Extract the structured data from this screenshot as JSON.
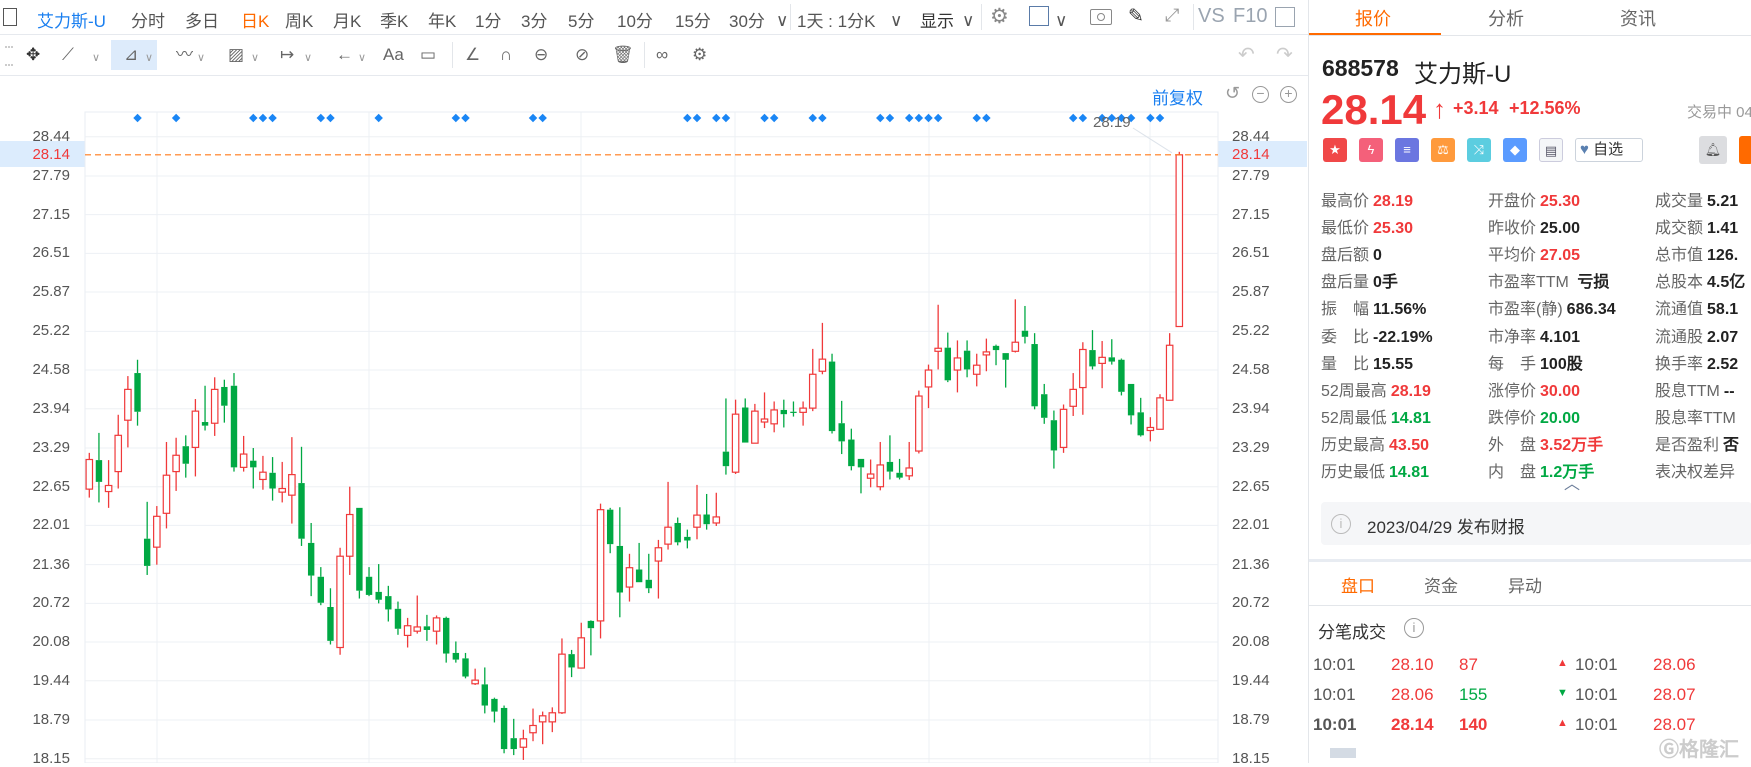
{
  "toolbar": {
    "stock_name": "艾力斯-U",
    "periods": [
      "分时",
      "多日",
      "日K",
      "周K",
      "月K",
      "季K",
      "年K",
      "1分",
      "3分",
      "5分",
      "10分",
      "15分",
      "30分"
    ],
    "active_period": "日K",
    "interval_select": "1天 : 1分K",
    "display_select": "显示",
    "vs": "VS",
    "f10": "F10"
  },
  "drawing_tools": [
    "move-icon",
    "line-icon",
    "polyline-icon",
    "wave-icon",
    "fibonacci-icon",
    "measure-icon",
    "arrow-icon",
    "text-icon",
    "comment-icon",
    "angle-icon",
    "magnet-icon",
    "link-icon",
    "hide-icon",
    "trash-icon",
    "overlay-icon",
    "settings-icon"
  ],
  "chart": {
    "adjust_label": "前复权",
    "high_label": "28.19",
    "current_price_label": "28.14"
  },
  "chart_data": {
    "type": "candlestick",
    "y_ticks": [
      "28.44",
      "27.79",
      "27.15",
      "26.51",
      "25.87",
      "25.22",
      "24.58",
      "23.94",
      "23.29",
      "22.65",
      "22.01",
      "21.36",
      "20.72",
      "20.08",
      "19.44",
      "18.79",
      "18.15"
    ],
    "ylim": [
      18.15,
      28.44
    ],
    "current_price": 28.14,
    "up_color": "#f0393a",
    "down_color": "#00a843",
    "marker_color": "#1a86f5",
    "current_line_color": "#ff7a1a",
    "grid": true,
    "event_markers_at_candle": [
      5,
      9,
      17,
      18,
      19,
      24,
      25,
      30,
      38,
      39,
      46,
      47,
      62,
      63,
      65,
      66,
      70,
      71,
      75,
      76,
      82,
      83,
      85,
      86,
      87,
      88,
      92,
      93,
      102,
      103,
      105,
      106,
      107,
      108,
      110,
      111
    ],
    "ohlc": [
      [
        22.61,
        23.21,
        22.47,
        23.1
      ],
      [
        23.09,
        23.54,
        22.39,
        22.73
      ],
      [
        22.57,
        23.09,
        22.3,
        22.67
      ],
      [
        22.9,
        23.84,
        22.62,
        23.5
      ],
      [
        23.75,
        24.48,
        23.3,
        24.26
      ],
      [
        24.53,
        24.75,
        23.66,
        23.89
      ],
      [
        21.79,
        22.4,
        21.19,
        21.34
      ],
      [
        21.65,
        22.33,
        21.36,
        22.16
      ],
      [
        22.21,
        23.39,
        21.96,
        22.84
      ],
      [
        22.9,
        23.46,
        22.58,
        23.17
      ],
      [
        23.32,
        23.5,
        22.8,
        23.03
      ],
      [
        23.3,
        24.1,
        22.82,
        23.9
      ],
      [
        23.72,
        24.32,
        23.58,
        23.66
      ],
      [
        23.7,
        24.46,
        23.49,
        24.26
      ],
      [
        24.3,
        24.42,
        23.71,
        23.99
      ],
      [
        24.32,
        24.53,
        22.9,
        22.97
      ],
      [
        22.97,
        23.49,
        22.9,
        23.19
      ],
      [
        23.08,
        23.29,
        22.62,
        22.97
      ],
      [
        22.77,
        23.16,
        22.6,
        22.89
      ],
      [
        22.88,
        23.14,
        22.42,
        22.62
      ],
      [
        22.56,
        23.06,
        22.39,
        22.62
      ],
      [
        22.51,
        23.47,
        22.04,
        22.85
      ],
      [
        22.71,
        23.31,
        21.67,
        21.79
      ],
      [
        21.72,
        22.05,
        20.84,
        21.18
      ],
      [
        21.16,
        21.32,
        20.69,
        20.73
      ],
      [
        20.66,
        20.97,
        20.04,
        20.1
      ],
      [
        19.99,
        21.64,
        19.87,
        21.5
      ],
      [
        21.5,
        22.65,
        21.19,
        22.19
      ],
      [
        22.3,
        22.3,
        20.8,
        20.93
      ],
      [
        21.16,
        21.32,
        20.84,
        20.86
      ],
      [
        20.91,
        21.37,
        20.72,
        20.78
      ],
      [
        20.84,
        21.01,
        20.42,
        20.62
      ],
      [
        20.63,
        20.75,
        20.2,
        20.3
      ],
      [
        20.19,
        20.48,
        19.99,
        20.35
      ],
      [
        20.26,
        20.85,
        20.22,
        20.33
      ],
      [
        20.34,
        20.53,
        20.1,
        20.28
      ],
      [
        20.26,
        20.52,
        20.04,
        20.48
      ],
      [
        20.48,
        20.5,
        19.74,
        19.89
      ],
      [
        19.9,
        20.09,
        19.74,
        19.79
      ],
      [
        19.81,
        19.9,
        19.48,
        19.51
      ],
      [
        19.39,
        19.64,
        19.37,
        19.45
      ],
      [
        19.38,
        19.66,
        18.9,
        19.03
      ],
      [
        19.14,
        19.16,
        18.75,
        18.93
      ],
      [
        18.99,
        19.03,
        18.24,
        18.31
      ],
      [
        18.49,
        18.81,
        18.21,
        18.31
      ],
      [
        18.34,
        18.63,
        18.13,
        18.48
      ],
      [
        18.58,
        18.98,
        18.44,
        18.7
      ],
      [
        18.76,
        18.93,
        18.39,
        18.86
      ],
      [
        18.76,
        19.0,
        18.59,
        18.91
      ],
      [
        18.91,
        20.14,
        18.89,
        19.88
      ],
      [
        19.88,
        19.95,
        19.5,
        19.66
      ],
      [
        19.65,
        20.4,
        19.65,
        20.15
      ],
      [
        20.43,
        20.44,
        19.86,
        20.31
      ],
      [
        20.43,
        22.37,
        20.14,
        22.27
      ],
      [
        22.27,
        22.3,
        21.55,
        21.7
      ],
      [
        21.67,
        22.31,
        20.49,
        20.9
      ],
      [
        20.99,
        21.54,
        20.75,
        21.31
      ],
      [
        21.28,
        21.72,
        21.07,
        21.07
      ],
      [
        21.11,
        21.54,
        20.89,
        20.97
      ],
      [
        21.42,
        21.77,
        20.8,
        21.64
      ],
      [
        21.7,
        22.73,
        21.61,
        21.98
      ],
      [
        22.05,
        22.14,
        21.68,
        21.73
      ],
      [
        21.82,
        21.94,
        21.63,
        21.76
      ],
      [
        21.98,
        22.68,
        21.78,
        22.18
      ],
      [
        22.19,
        22.53,
        21.94,
        22.03
      ],
      [
        22.05,
        22.55,
        22.0,
        22.15
      ],
      [
        23.23,
        24.11,
        22.85,
        22.99
      ],
      [
        22.89,
        24.09,
        22.86,
        23.85
      ],
      [
        23.96,
        24.11,
        23.38,
        23.38
      ],
      [
        23.37,
        24.02,
        23.37,
        23.9
      ],
      [
        23.72,
        24.21,
        23.62,
        23.77
      ],
      [
        23.69,
        24.06,
        23.55,
        23.92
      ],
      [
        23.92,
        24.09,
        23.63,
        23.85
      ],
      [
        23.89,
        24.06,
        23.81,
        23.88
      ],
      [
        23.88,
        24.06,
        23.66,
        23.95
      ],
      [
        23.95,
        24.93,
        23.9,
        24.51
      ],
      [
        24.56,
        25.36,
        24.51,
        24.76
      ],
      [
        24.72,
        24.85,
        23.53,
        23.57
      ],
      [
        23.7,
        24.07,
        23.19,
        23.4
      ],
      [
        23.43,
        23.61,
        22.92,
        22.99
      ],
      [
        23.11,
        23.11,
        22.54,
        22.97
      ],
      [
        22.79,
        23.1,
        22.64,
        22.86
      ],
      [
        22.65,
        23.39,
        22.59,
        23.01
      ],
      [
        23.06,
        23.5,
        22.77,
        22.9
      ],
      [
        22.88,
        23.11,
        22.77,
        22.8
      ],
      [
        22.83,
        23.39,
        22.76,
        22.96
      ],
      [
        23.24,
        24.24,
        23.2,
        24.15
      ],
      [
        24.3,
        24.67,
        23.95,
        24.58
      ],
      [
        24.89,
        25.66,
        24.59,
        24.94
      ],
      [
        24.95,
        25.2,
        24.38,
        24.41
      ],
      [
        24.58,
        25.07,
        24.21,
        24.78
      ],
      [
        24.9,
        25.07,
        24.46,
        24.59
      ],
      [
        24.51,
        24.85,
        24.31,
        24.66
      ],
      [
        24.83,
        25.1,
        24.56,
        24.88
      ],
      [
        24.98,
        25.0,
        24.66,
        24.91
      ],
      [
        24.86,
        24.86,
        24.29,
        24.75
      ],
      [
        24.89,
        25.75,
        24.87,
        25.04
      ],
      [
        25.23,
        25.64,
        25.02,
        25.13
      ],
      [
        25.01,
        25.19,
        23.93,
        23.98
      ],
      [
        24.18,
        24.35,
        23.69,
        23.79
      ],
      [
        23.75,
        23.91,
        22.95,
        23.25
      ],
      [
        23.3,
        24.01,
        23.21,
        23.93
      ],
      [
        23.98,
        24.53,
        23.82,
        24.26
      ],
      [
        24.29,
        25.04,
        23.84,
        24.92
      ],
      [
        24.91,
        25.24,
        24.59,
        24.64
      ],
      [
        24.69,
        25.06,
        24.28,
        24.79
      ],
      [
        24.79,
        25.09,
        24.67,
        24.72
      ],
      [
        24.75,
        24.77,
        24.16,
        24.22
      ],
      [
        24.35,
        24.35,
        23.68,
        23.83
      ],
      [
        23.88,
        24.12,
        23.48,
        23.5
      ],
      [
        23.58,
        23.8,
        23.4,
        23.63
      ],
      [
        23.6,
        24.18,
        23.6,
        24.12
      ],
      [
        24.08,
        25.19,
        24.08,
        24.99
      ],
      [
        25.3,
        28.19,
        25.3,
        28.14
      ]
    ]
  },
  "panel": {
    "tabs": [
      "报价",
      "分析",
      "资讯"
    ],
    "code": "688578",
    "name": "艾力斯-U",
    "price": "28.14",
    "arrow": "↑",
    "change": "+3.14",
    "change_pct": "+12.56%",
    "status": "交易中 04",
    "watch_label": "自选",
    "stats": [
      [
        {
          "l": "最高价",
          "v": "28.19",
          "c": "red"
        },
        {
          "l": "最低价",
          "v": "25.30",
          "c": "red"
        },
        {
          "l": "盘后额",
          "v": "0",
          "c": ""
        },
        {
          "l": "盘后量",
          "v": "0手",
          "c": ""
        },
        {
          "l": "振　幅",
          "v": "11.56%",
          "c": ""
        },
        {
          "l": "委　比",
          "v": "-22.19%",
          "c": ""
        },
        {
          "l": "量　比",
          "v": "15.55",
          "c": ""
        },
        {
          "l": "52周最高",
          "v": "28.19",
          "c": "red"
        },
        {
          "l": "52周最低",
          "v": "14.81",
          "c": "green"
        },
        {
          "l": "历史最高",
          "v": "43.50",
          "c": "red"
        },
        {
          "l": "历史最低",
          "v": "14.81",
          "c": "green"
        }
      ],
      [
        {
          "l": "开盘价",
          "v": "25.30",
          "c": "red"
        },
        {
          "l": "昨收价",
          "v": "25.00",
          "c": ""
        },
        {
          "l": "平均价",
          "v": "27.05",
          "c": "red"
        },
        {
          "l": "市盈率TTM",
          "v": " 亏损",
          "c": ""
        },
        {
          "l": "市盈率(静)",
          "v": "686.34",
          "c": ""
        },
        {
          "l": "市净率",
          "v": "4.101",
          "c": ""
        },
        {
          "l": "每　手",
          "v": "100股",
          "c": ""
        },
        {
          "l": "涨停价",
          "v": "30.00",
          "c": "red"
        },
        {
          "l": "跌停价",
          "v": "20.00",
          "c": "green"
        },
        {
          "l": "外　盘",
          "v": "3.52万手",
          "c": "red"
        },
        {
          "l": "内　盘",
          "v": "1.2万手",
          "c": "green"
        }
      ],
      [
        {
          "l": "成交量",
          "v": "5.21",
          "c": ""
        },
        {
          "l": "成交额",
          "v": "1.41",
          "c": ""
        },
        {
          "l": "总市值",
          "v": "126.",
          "c": ""
        },
        {
          "l": "总股本",
          "v": "4.5亿",
          "c": ""
        },
        {
          "l": "流通值",
          "v": "58.1",
          "c": ""
        },
        {
          "l": "流通股",
          "v": "2.07",
          "c": ""
        },
        {
          "l": "换手率",
          "v": "2.52",
          "c": ""
        },
        {
          "l": "股息TTM",
          "v": "--",
          "c": ""
        },
        {
          "l": "股息率TTM",
          "v": "",
          "c": ""
        },
        {
          "l": "是否盈利",
          "v": "否",
          "c": ""
        },
        {
          "l": "表决权差异",
          "v": "",
          "c": ""
        }
      ]
    ],
    "notice": "2023/04/29  发布财报",
    "sub_tabs": [
      "盘口",
      "资金",
      "异动"
    ],
    "ticks_title": "分笔成交",
    "ticks": [
      {
        "t": "10:01",
        "p": "28.10",
        "v": "87",
        "dir": "up",
        "t2": "10:01",
        "p2": "28.06"
      },
      {
        "t": "10:01",
        "p": "28.06",
        "v": "155",
        "dir": "down",
        "t2": "10:01",
        "p2": "28.07"
      },
      {
        "t": "10:01",
        "p": "28.14",
        "v": "140",
        "dir": "up",
        "t2": "10:01",
        "p2": "28.07"
      }
    ],
    "watermark": "格隆汇"
  }
}
